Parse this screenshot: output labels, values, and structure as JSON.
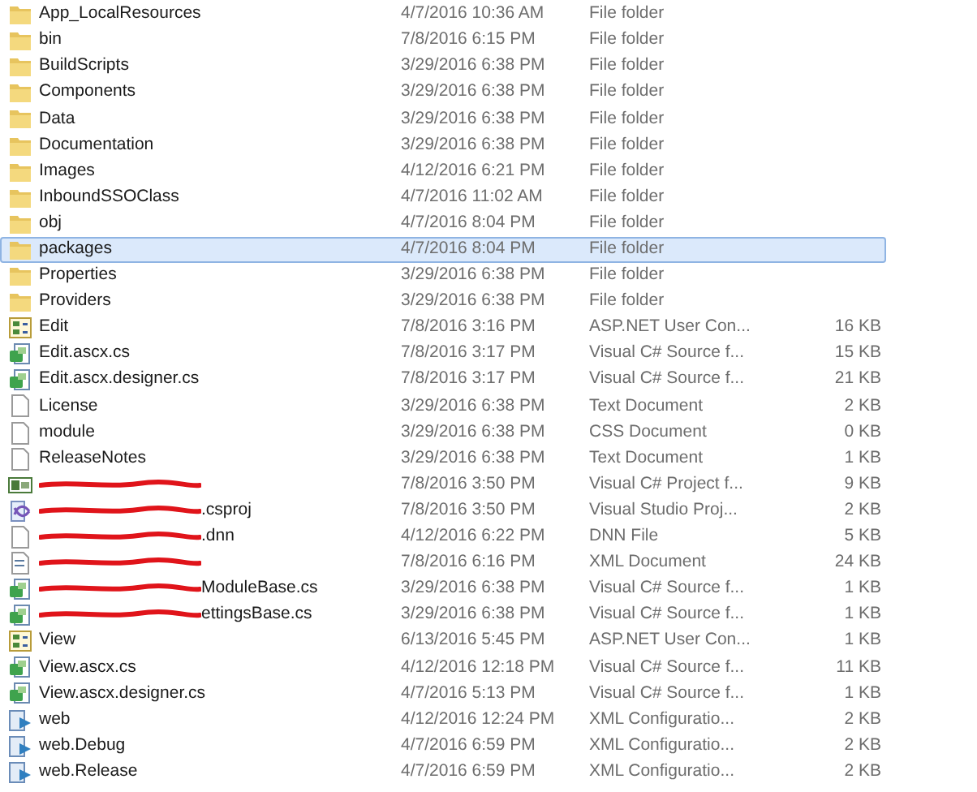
{
  "files": [
    {
      "name": "App_LocalResources",
      "date": "4/7/2016 10:36 AM",
      "type": "File folder",
      "kind": "folder",
      "selected": false
    },
    {
      "name": "bin",
      "date": "7/8/2016 6:15 PM",
      "type": "File folder",
      "kind": "folder",
      "selected": false
    },
    {
      "name": "BuildScripts",
      "date": "3/29/2016 6:38 PM",
      "type": "File folder",
      "kind": "folder",
      "selected": false
    },
    {
      "name": "Components",
      "date": "3/29/2016 6:38 PM",
      "type": "File folder",
      "kind": "folder",
      "selected": false
    },
    {
      "name": "Data",
      "date": "3/29/2016 6:38 PM",
      "type": "File folder",
      "kind": "folder",
      "selected": false
    },
    {
      "name": "Documentation",
      "date": "3/29/2016 6:38 PM",
      "type": "File folder",
      "kind": "folder",
      "selected": false
    },
    {
      "name": "Images",
      "date": "4/12/2016 6:21 PM",
      "type": "File folder",
      "kind": "folder",
      "selected": false
    },
    {
      "name": "InboundSSOClass",
      "date": "4/7/2016 11:02 AM",
      "type": "File folder",
      "kind": "folder",
      "selected": false
    },
    {
      "name": "obj",
      "date": "4/7/2016 8:04 PM",
      "type": "File folder",
      "kind": "folder",
      "selected": false
    },
    {
      "name": "packages",
      "date": "4/7/2016 8:04 PM",
      "type": "File folder",
      "kind": "folder",
      "selected": true
    },
    {
      "name": "Properties",
      "date": "3/29/2016 6:38 PM",
      "type": "File folder",
      "kind": "folder",
      "selected": false
    },
    {
      "name": "Providers",
      "date": "3/29/2016 6:38 PM",
      "type": "File folder",
      "kind": "folder",
      "selected": false
    },
    {
      "name": "Edit",
      "date": "7/8/2016 3:16 PM",
      "type": "ASP.NET User Con...",
      "size": "16 KB",
      "kind": "control",
      "selected": false
    },
    {
      "name": "Edit.ascx.cs",
      "date": "7/8/2016 3:17 PM",
      "type": "Visual C# Source f...",
      "size": "15 KB",
      "kind": "source",
      "selected": false
    },
    {
      "name": "Edit.ascx.designer.cs",
      "date": "7/8/2016 3:17 PM",
      "type": "Visual C# Source f...",
      "size": "21 KB",
      "kind": "source",
      "selected": false
    },
    {
      "name": "License",
      "date": "3/29/2016 6:38 PM",
      "type": "Text Document",
      "size": "2 KB",
      "kind": "document",
      "selected": false
    },
    {
      "name": "module",
      "date": "3/29/2016 6:38 PM",
      "type": "CSS Document",
      "size": "0 KB",
      "kind": "document",
      "selected": false
    },
    {
      "name": "ReleaseNotes",
      "date": "3/29/2016 6:38 PM",
      "type": "Text Document",
      "size": "1 KB",
      "kind": "document",
      "selected": false
    },
    {
      "redacted": true,
      "date": "7/8/2016 3:50 PM",
      "type": "Visual C# Project f...",
      "size": "9 KB",
      "kind": "project",
      "selected": false
    },
    {
      "redacted": true,
      "name": ".csproj",
      "date": "7/8/2016 3:50 PM",
      "type": "Visual Studio Proj...",
      "size": "2 KB",
      "kind": "studio",
      "selected": false
    },
    {
      "redacted": true,
      "name": ".dnn",
      "date": "4/12/2016 6:22 PM",
      "type": "DNN File",
      "size": "5 KB",
      "kind": "document",
      "selected": false
    },
    {
      "redacted": true,
      "date": "7/8/2016 6:16 PM",
      "type": "XML Document",
      "size": "24 KB",
      "kind": "xml",
      "selected": false
    },
    {
      "redacted": true,
      "name": "ModuleBase.cs",
      "date": "3/29/2016 6:38 PM",
      "type": "Visual C# Source f...",
      "size": "1 KB",
      "kind": "source",
      "selected": false
    },
    {
      "redacted": true,
      "name": "ettingsBase.cs",
      "date": "3/29/2016 6:38 PM",
      "type": "Visual C# Source f...",
      "size": "1 KB",
      "kind": "source",
      "selected": false
    },
    {
      "name": "View",
      "date": "6/13/2016 5:45 PM",
      "type": "ASP.NET User Con...",
      "size": "1 KB",
      "kind": "control",
      "selected": false
    },
    {
      "name": "View.ascx.cs",
      "date": "4/12/2016 12:18 PM",
      "type": "Visual C# Source f...",
      "size": "11 KB",
      "kind": "source",
      "selected": false
    },
    {
      "name": "View.ascx.designer.cs",
      "date": "4/7/2016 5:13 PM",
      "type": "Visual C# Source f...",
      "size": "1 KB",
      "kind": "source",
      "selected": false
    },
    {
      "name": "web",
      "date": "4/12/2016 12:24 PM",
      "type": "XML Configuratio...",
      "size": "2 KB",
      "kind": "config",
      "selected": false
    },
    {
      "name": "web.Debug",
      "date": "4/7/2016 6:59 PM",
      "type": "XML Configuratio...",
      "size": "2 KB",
      "kind": "config",
      "selected": false
    },
    {
      "name": "web.Release",
      "date": "4/7/2016 6:59 PM",
      "type": "XML Configuratio...",
      "size": "2 KB",
      "kind": "config",
      "selected": false
    }
  ]
}
